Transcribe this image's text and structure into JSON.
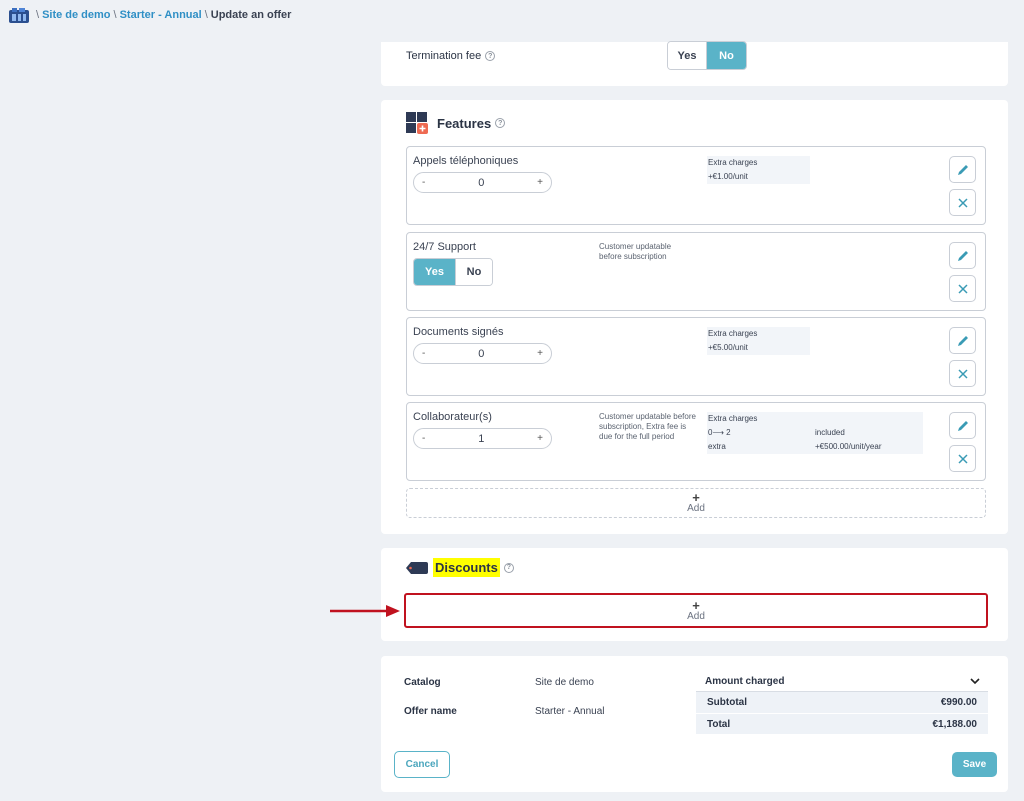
{
  "breadcrumb": {
    "site": "Site de demo",
    "plan": "Starter - Annual",
    "current": "Update an offer",
    "separator": "\\"
  },
  "termination": {
    "label": "Termination fee",
    "yes": "Yes",
    "no": "No",
    "selected": "No"
  },
  "features": {
    "title": "Features",
    "items": [
      {
        "name": "Appels téléphoniques",
        "value": "0",
        "minus": "-",
        "plus": "+",
        "charges_title": "Extra charges",
        "charges_line": "+€1.00/unit"
      },
      {
        "name": "24/7 Support",
        "yes": "Yes",
        "no": "No",
        "selected": "Yes",
        "note": "Customer updatable before subscription"
      },
      {
        "name": "Documents signés",
        "value": "0",
        "minus": "-",
        "plus": "+",
        "charges_title": "Extra charges",
        "charges_line": "+€5.00/unit"
      },
      {
        "name": "Collaborateur(s)",
        "value": "1",
        "minus": "-",
        "plus": "+",
        "note": "Customer updatable before subscription, Extra fee is due for the full period",
        "charges_title": "Extra charges",
        "tier1_range": "0⟶ 2",
        "tier1_price": "included",
        "tier2_range": "extra",
        "tier2_price": "+€500.00/unit/year"
      }
    ],
    "add_label": "Add",
    "add_plus": "+"
  },
  "discounts": {
    "title": "Discounts",
    "add_label": "Add",
    "add_plus": "+",
    "badge_text": "%"
  },
  "summary": {
    "catalog_label": "Catalog",
    "catalog_value": "Site de demo",
    "offer_label": "Offer name",
    "offer_value": "Starter - Annual",
    "amount_title": "Amount charged",
    "subtotal_label": "Subtotal",
    "subtotal_value": "€990.00",
    "total_label": "Total",
    "total_value": "€1,188.00",
    "cancel": "Cancel",
    "save": "Save"
  },
  "help_glyph": "?",
  "colors": {
    "accent": "#5ab3c8",
    "link": "#2f8fc5",
    "highlight": "#ffff00",
    "annotation": "#c0121f"
  }
}
